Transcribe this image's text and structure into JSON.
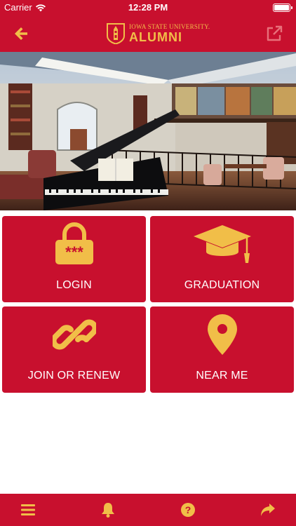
{
  "status_bar": {
    "carrier": "Carrier",
    "time": "12:28 PM",
    "battery_level": 1.0
  },
  "nav_bar": {
    "back_icon": "arrow-left-icon",
    "logo_university": "IOWA STATE UNIVERSITY.",
    "logo_alumni": "ALUMNI",
    "external_link_icon": "external-link-icon"
  },
  "tiles": [
    {
      "label": "LOGIN",
      "icon": "password-lock-icon"
    },
    {
      "label": "GRADUATION",
      "icon": "graduation-cap-icon"
    },
    {
      "label": "JOIN OR RENEW",
      "icon": "chain-link-icon"
    },
    {
      "label": "NEAR ME",
      "icon": "map-pin-icon"
    }
  ],
  "tab_bar": [
    {
      "icon": "menu-icon"
    },
    {
      "icon": "bell-icon"
    },
    {
      "icon": "help-icon"
    },
    {
      "icon": "share-arrow-icon"
    }
  ],
  "colors": {
    "brand_red": "#c8102e",
    "brand_gold": "#f1be48",
    "text_white": "#ffffff"
  }
}
